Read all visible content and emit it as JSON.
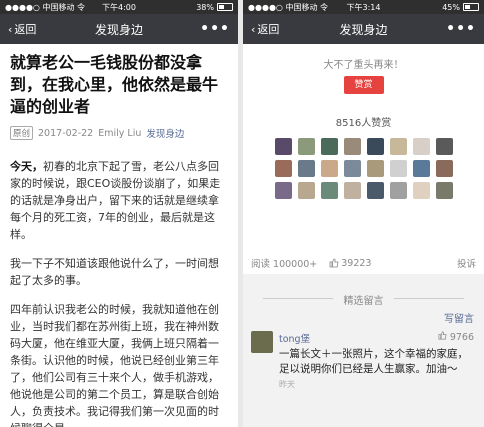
{
  "left": {
    "status": {
      "carrier": "●●●●○ 中国移动 令",
      "time": "下午4:00",
      "battery": "38%",
      "battery_level": 0.38
    },
    "nav": {
      "back": "返回",
      "title": "发现身边",
      "more": "•••"
    },
    "article": {
      "title": "就算老公一毛钱股份都没拿到，在我心里，他依然是最牛逼的创业者",
      "tag": "原创",
      "date": "2017-02-22",
      "author": "Emily Liu",
      "account": "发现身边",
      "p1_lead": "今天，",
      "p1_rest": "初春的北京下起了雪，老公八点多回家的时候说，跟CEO谈股份谈崩了，如果走的话就是净身出户，留下来的话就是继续拿每个月的死工资，7年的创业，最后就是这样。",
      "p2": "我一下子不知道该跟他说什么了，一时间想起了太多的事。",
      "p3": "四年前认识我老公的时候，我就知道他在创业，当时我们都在苏州街上班，我在神州数码大厦，他在维亚大厦，我俩上班只隔着一条街。认识他的时候，他说已经创业第三年了，他们公司有三十来个人，做手机游戏，他说他是公司的第二个员工，算是联合创始人，负责技术。我记得我们第一次见面的时候聊得全是"
    }
  },
  "right": {
    "status": {
      "carrier": "●●●●○ 中国移动 令",
      "time": "下午3:14",
      "battery": "45%",
      "battery_level": 0.45
    },
    "nav": {
      "back": "返回",
      "title": "发现身边",
      "more": "•••"
    },
    "reward": {
      "message": "大不了重头再来！",
      "button": "赞赏",
      "count": "8516人赞赏"
    },
    "avatar_colors": [
      "#5a4a6a",
      "#8a9a7a",
      "#4a6a5a",
      "#9a8a7a",
      "#3a4a5a",
      "#c8b89a",
      "#d8d0c8",
      "#5a5a5a",
      "#9a6a5a",
      "#6a7a8a",
      "#caa88a",
      "#7a8a9a",
      "#a89a7a",
      "#d0d0d0",
      "#5a7a9a",
      "#8a6a5a",
      "#7a6a8a",
      "#b8a890",
      "#6a8a7a",
      "#c0b0a0",
      "#4a5a6a",
      "#a0a0a0",
      "#e0d0c0",
      "#7a7a6a"
    ],
    "stats": {
      "reads": "阅读 100000+",
      "likes": "39223",
      "complain": "投诉"
    },
    "comments": {
      "section_title": "精选留言",
      "write": "写留言",
      "items": [
        {
          "nick": "tong堡",
          "likes": "9766",
          "text": "一篇长文＋一张照片，这个幸福的家庭，足以说明你们已经是人生赢家。加油～",
          "time": "昨天"
        }
      ]
    }
  }
}
